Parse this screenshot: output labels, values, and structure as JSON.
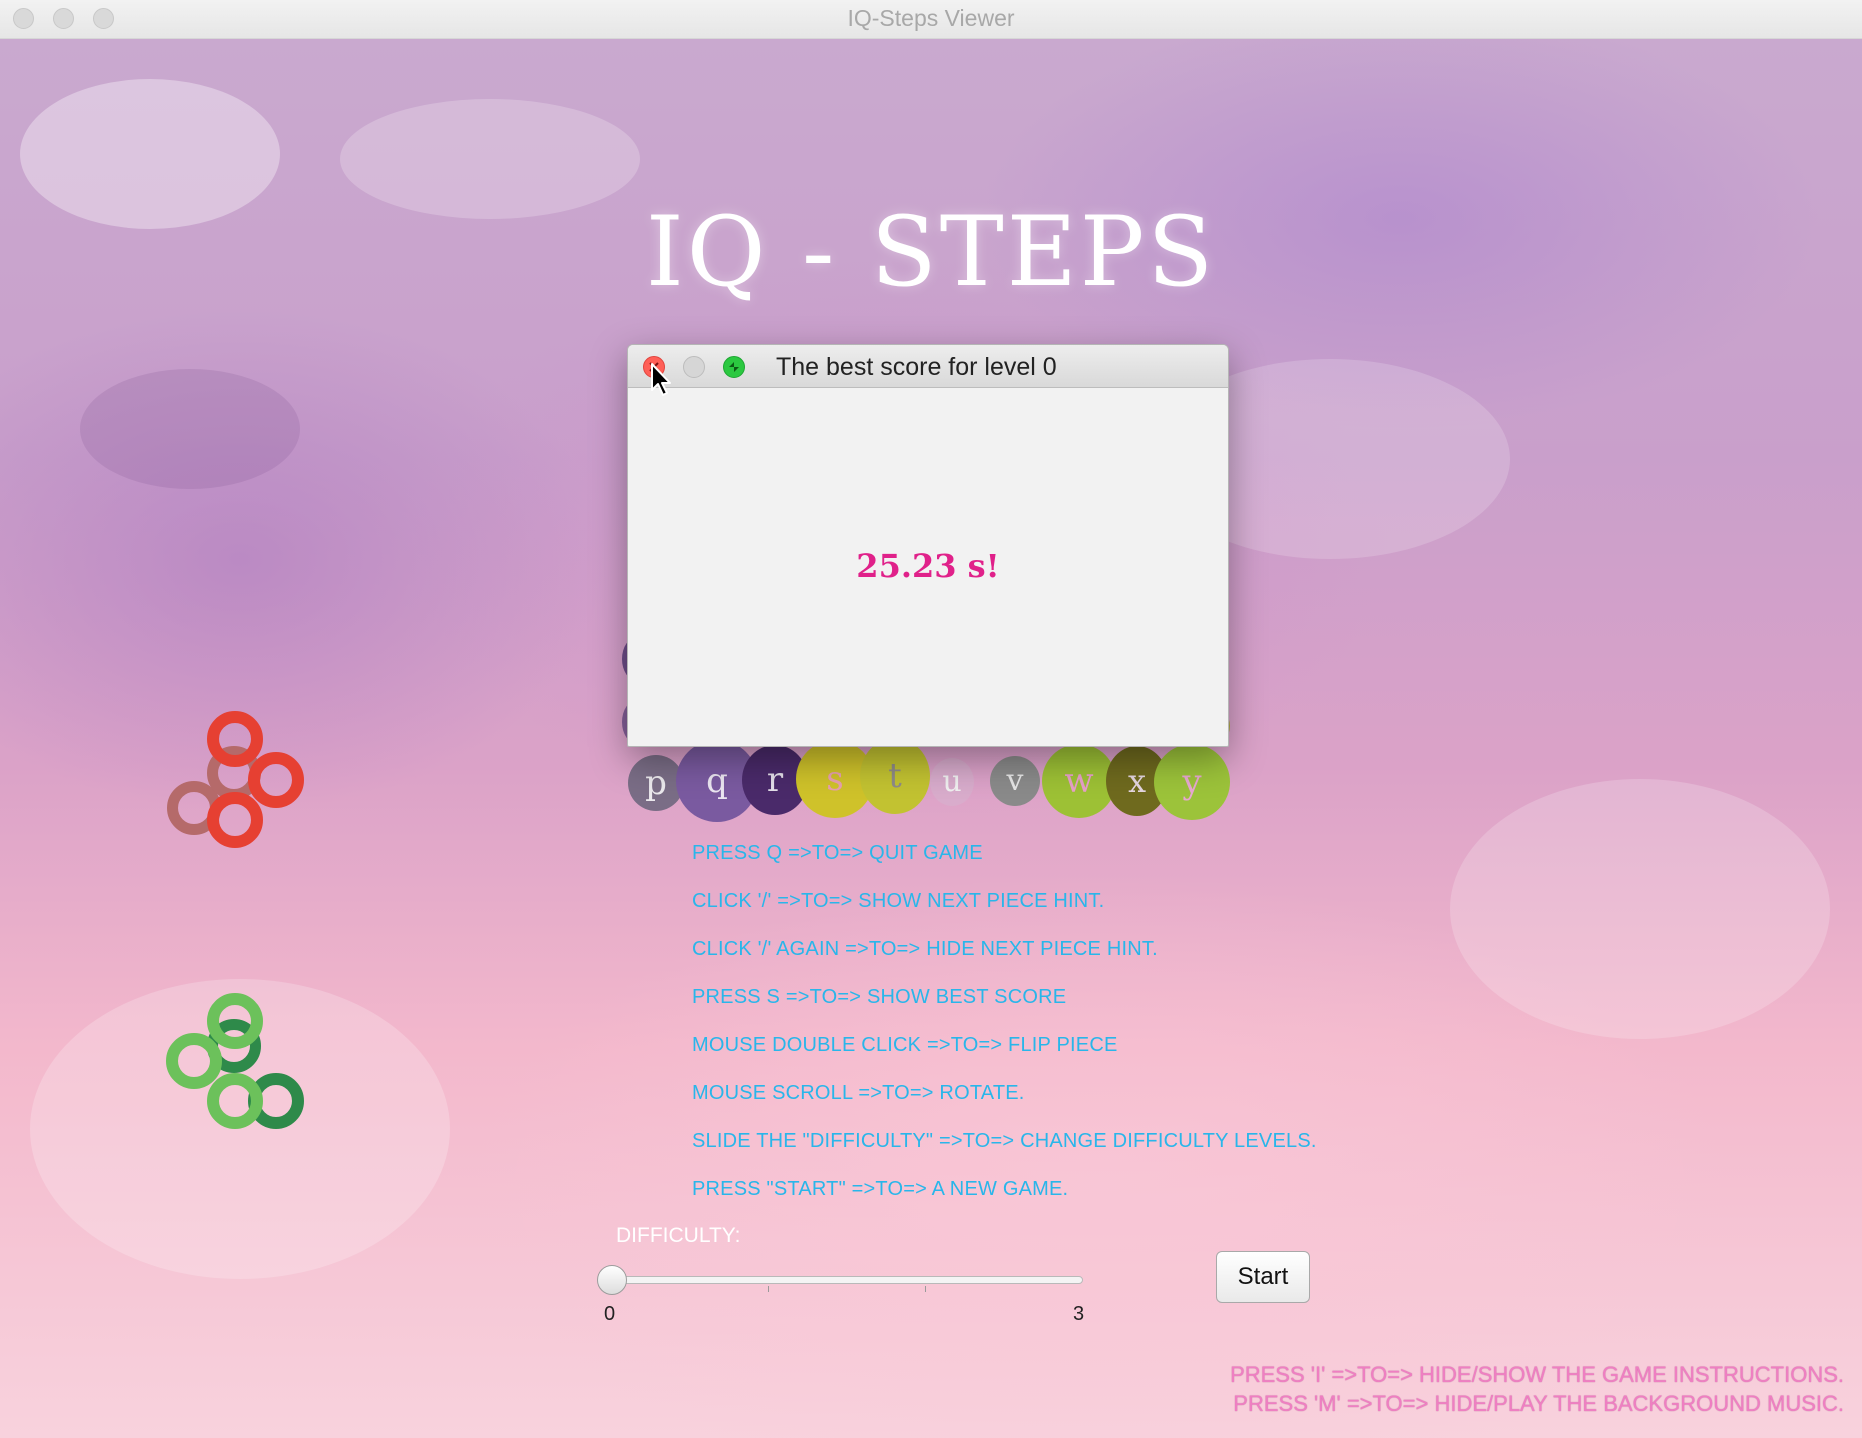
{
  "window": {
    "title": "IQ-Steps Viewer"
  },
  "game": {
    "title": "IQ - STEPS"
  },
  "pieces_row": {
    "letters": [
      "p",
      "q",
      "r",
      "s",
      "t",
      "u",
      "v",
      "w",
      "x",
      "y"
    ]
  },
  "instructions": [
    "PRESS Q =>TO=> QUIT GAME",
    "CLICK '/' =>TO=> SHOW NEXT PIECE HINT.",
    "CLICK '/' AGAIN =>TO=> HIDE NEXT PIECE HINT.",
    "PRESS S =>TO=> SHOW BEST SCORE",
    "MOUSE DOUBLE CLICK =>TO=> FLIP PIECE",
    "MOUSE SCROLL =>TO=> ROTATE.",
    "SLIDE THE \"DIFFICULTY\" =>TO=> CHANGE DIFFICULTY LEVELS.",
    "PRESS \"START\" =>TO=> A NEW GAME."
  ],
  "difficulty": {
    "label": "DIFFICULTY:",
    "min_label": "0",
    "max_label": "3",
    "value": 0
  },
  "start_button": {
    "label": "Start"
  },
  "footer": {
    "line1": "PRESS 'I' =>TO=> HIDE/SHOW THE GAME INSTRUCTIONS.",
    "line2": "PRESS 'M' =>TO=> HIDE/PLAY THE BACKGROUND MUSIC."
  },
  "dialog": {
    "title": "The best score for level 0",
    "score": "25.23 s!"
  },
  "colors": {
    "instruction_text": "#29b6ea",
    "score_text": "#e0218a",
    "footer_text": "#ef7fc2"
  }
}
